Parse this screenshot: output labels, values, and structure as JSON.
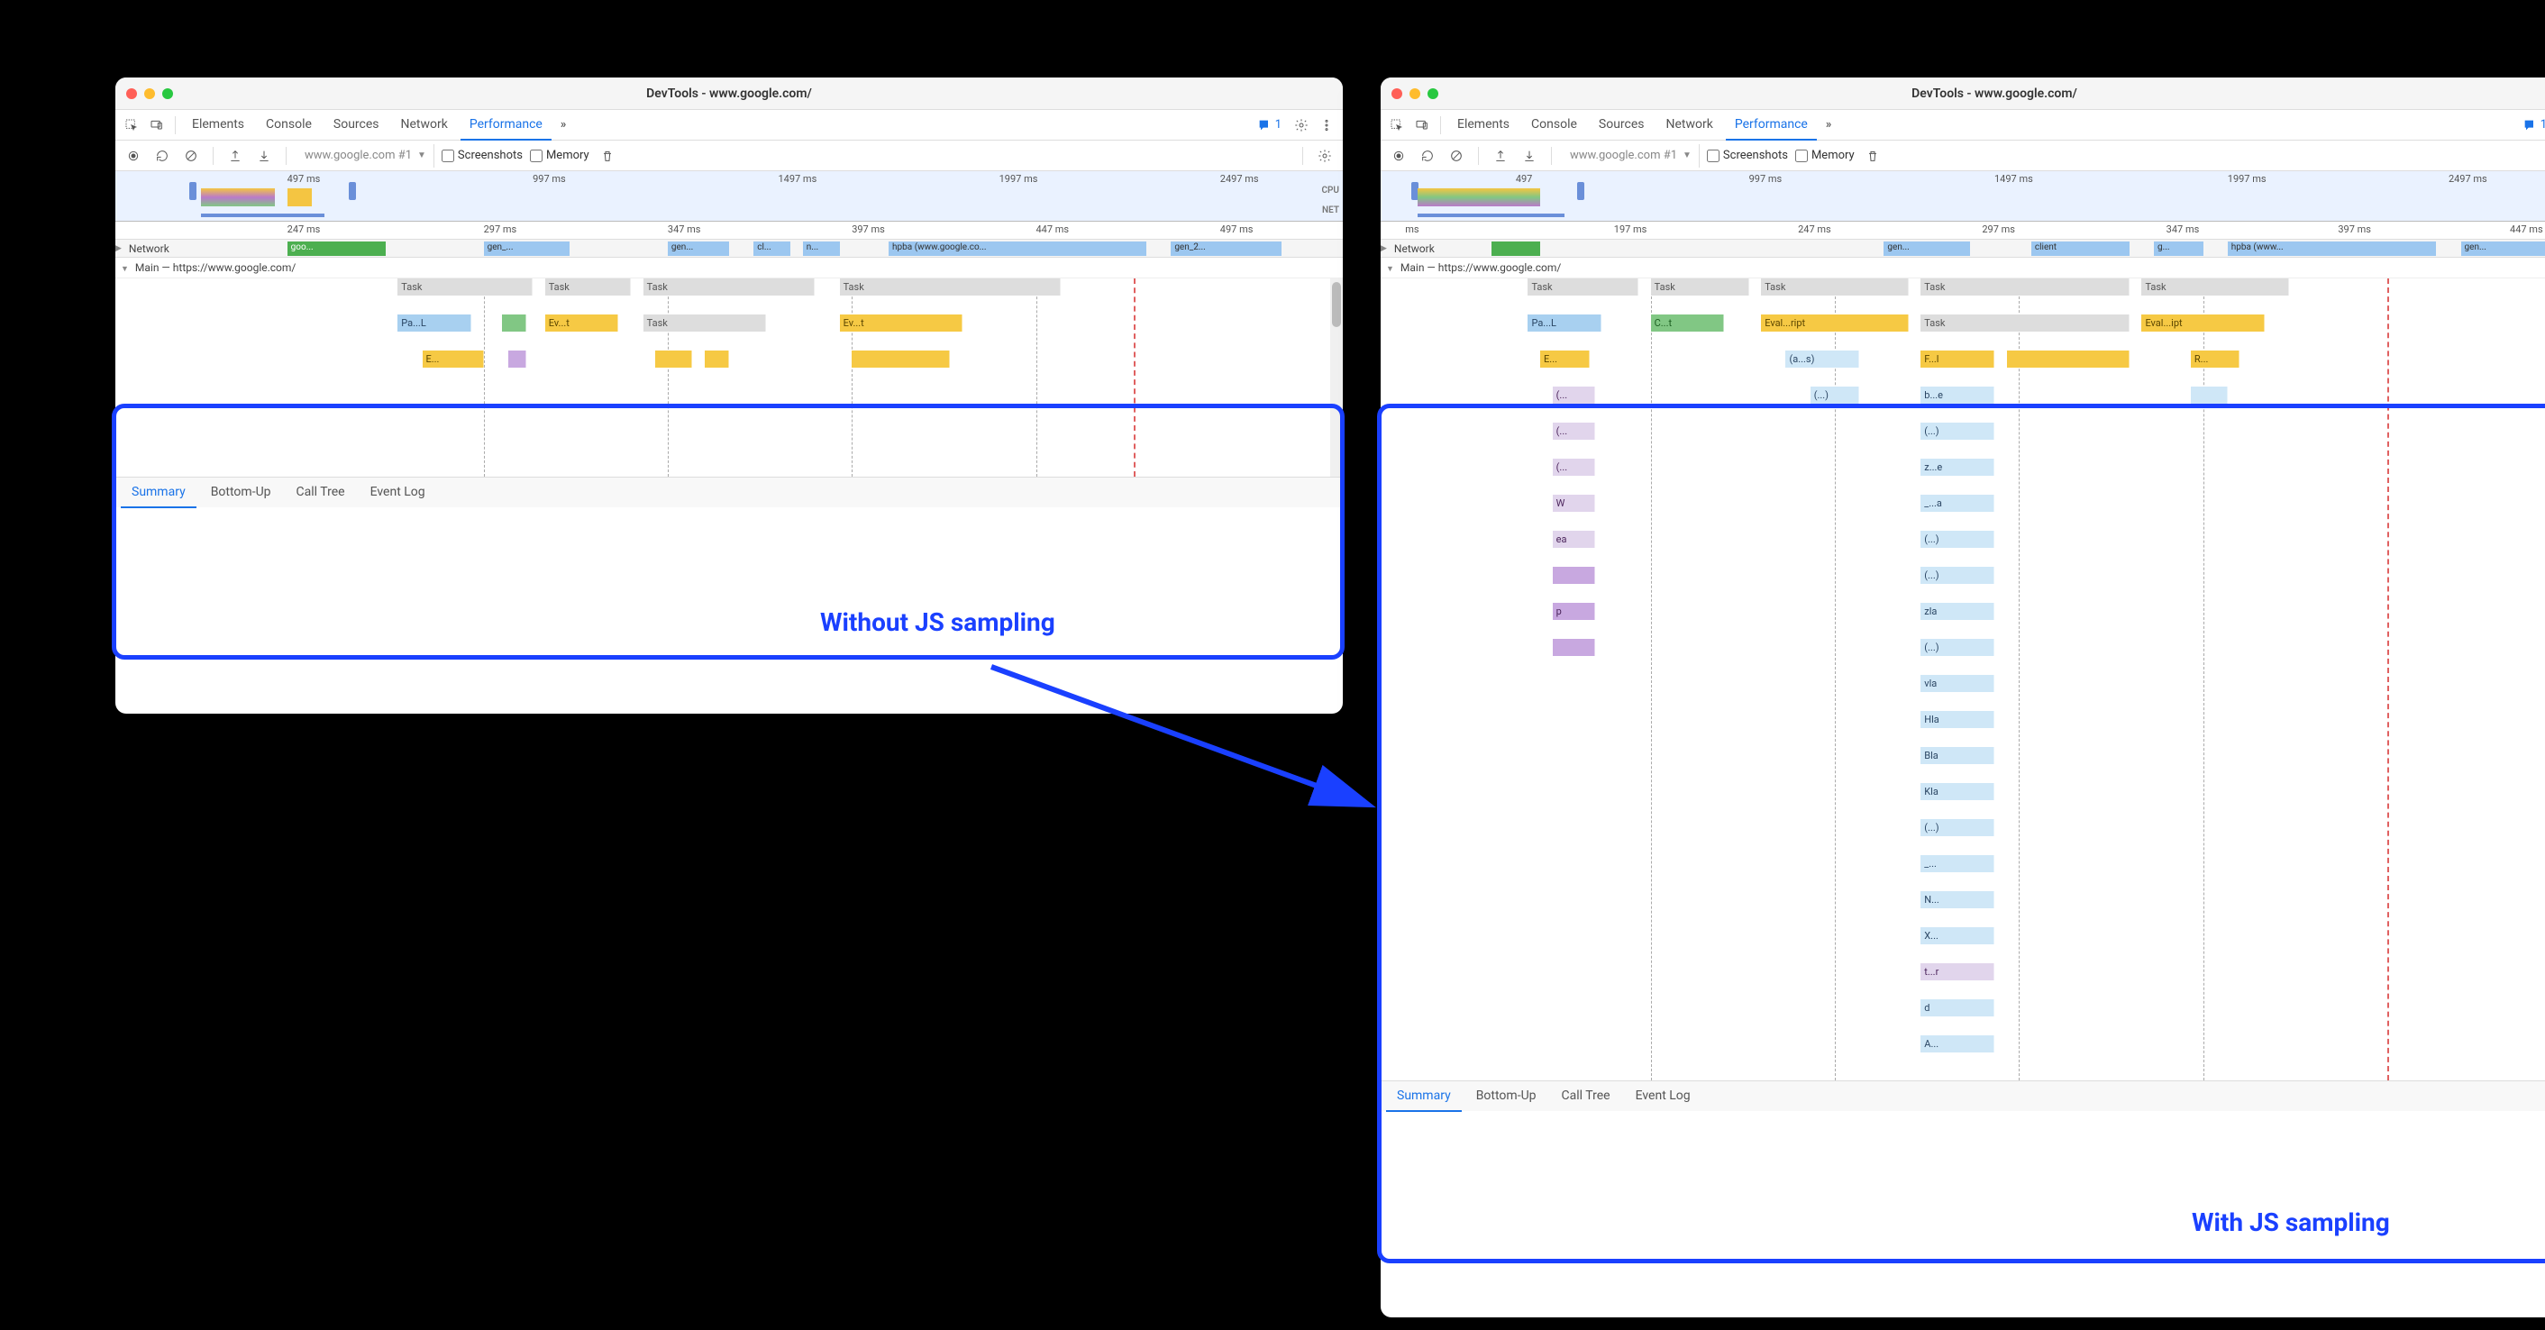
{
  "colors": {
    "accent": "#1a73e8",
    "annotation": "#1a40ff"
  },
  "window_left": {
    "title": "DevTools - www.google.com/",
    "tabs": [
      "Elements",
      "Console",
      "Sources",
      "Network",
      "Performance"
    ],
    "active_tab": "Performance",
    "issues_count": "1",
    "recording_dropdown": "www.google.com #1",
    "checkboxes": {
      "screenshots": "Screenshots",
      "memory": "Memory"
    },
    "overview_ticks": [
      "497 ms",
      "997 ms",
      "1497 ms",
      "1997 ms",
      "2497 ms"
    ],
    "overview_labels": {
      "cpu": "CPU",
      "net": "NET"
    },
    "ruler_ticks": [
      "247 ms",
      "297 ms",
      "347 ms",
      "397 ms",
      "447 ms",
      "497 ms"
    ],
    "network_label": "Network",
    "network_items": [
      "goo...",
      "gen_...",
      "gen...",
      "cl...",
      "n...",
      "hpba (www.google.co...",
      "gen_2..."
    ],
    "main_label": "Main — https://www.google.com/",
    "flame_rows": [
      [
        {
          "l": "Task",
          "c": "c-gray",
          "x": 23,
          "w": 11
        },
        {
          "l": "Task",
          "c": "c-gray",
          "x": 35,
          "w": 7
        },
        {
          "l": "Task",
          "c": "c-gray",
          "x": 43,
          "w": 14
        },
        {
          "l": "Task",
          "c": "c-gray",
          "x": 59,
          "w": 18
        }
      ],
      [
        {
          "l": "Pa...L",
          "c": "c-blue",
          "x": 23,
          "w": 6
        },
        {
          "l": "",
          "c": "c-green",
          "x": 31.5,
          "w": 2
        },
        {
          "l": "Ev...t",
          "c": "c-yellow",
          "x": 35,
          "w": 6
        },
        {
          "l": "Task",
          "c": "c-gray",
          "x": 43,
          "w": 10
        },
        {
          "l": "Ev...t",
          "c": "c-yellow",
          "x": 59,
          "w": 10
        }
      ],
      [
        {
          "l": "E...",
          "c": "c-yellow",
          "x": 25,
          "w": 5
        },
        {
          "l": "",
          "c": "c-purple",
          "x": 32,
          "w": 1.5
        },
        {
          "l": "",
          "c": "c-yellow",
          "x": 44,
          "w": 3
        },
        {
          "l": "",
          "c": "c-yellow",
          "x": 48,
          "w": 2
        },
        {
          "l": "",
          "c": "c-yellow",
          "x": 60,
          "w": 8
        }
      ]
    ],
    "annotation": "Without JS sampling",
    "details_tabs": [
      "Summary",
      "Bottom-Up",
      "Call Tree",
      "Event Log"
    ],
    "active_details_tab": "Summary"
  },
  "window_right": {
    "title": "DevTools - www.google.com/",
    "tabs": [
      "Elements",
      "Console",
      "Sources",
      "Network",
      "Performance"
    ],
    "active_tab": "Performance",
    "issues_count": "1",
    "recording_dropdown": "www.google.com #1",
    "checkboxes": {
      "screenshots": "Screenshots",
      "memory": "Memory"
    },
    "overview_ticks": [
      "497",
      "997 ms",
      "1497 ms",
      "1997 ms",
      "2497 ms"
    ],
    "overview_labels": {
      "cpu": "CPU",
      "net": "NET"
    },
    "ruler_ticks": [
      "ms",
      "197 ms",
      "247 ms",
      "297 ms",
      "347 ms",
      "397 ms",
      "447 ms"
    ],
    "network_label": "Network",
    "network_items": [
      "gen...",
      "client",
      "g...",
      "hpba (www...",
      "gen..."
    ],
    "main_label": "Main — https://www.google.com/",
    "flame_rows": [
      [
        {
          "l": "Task",
          "c": "c-gray",
          "x": 12,
          "w": 9
        },
        {
          "l": "Task",
          "c": "c-gray",
          "x": 22,
          "w": 8
        },
        {
          "l": "Task",
          "c": "c-gray",
          "x": 31,
          "w": 12
        },
        {
          "l": "Task",
          "c": "c-gray",
          "x": 44,
          "w": 17
        },
        {
          "l": "Task",
          "c": "c-gray",
          "x": 62,
          "w": 12
        }
      ],
      [
        {
          "l": "Pa...L",
          "c": "c-blue",
          "x": 12,
          "w": 6
        },
        {
          "l": "C...t",
          "c": "c-green",
          "x": 22,
          "w": 6
        },
        {
          "l": "Eval...ript",
          "c": "c-yellow",
          "x": 31,
          "w": 12
        },
        {
          "l": "Task",
          "c": "c-gray",
          "x": 44,
          "w": 17
        },
        {
          "l": "Eval...ipt",
          "c": "c-yellow",
          "x": 62,
          "w": 10
        }
      ],
      [
        {
          "l": "E...",
          "c": "c-yellow",
          "x": 13,
          "w": 4
        },
        {
          "l": "(a...s)",
          "c": "c-lightblue",
          "x": 33,
          "w": 6
        },
        {
          "l": "F...l",
          "c": "c-yellow",
          "x": 44,
          "w": 6
        },
        {
          "l": "",
          "c": "c-yellow",
          "x": 51,
          "w": 10
        },
        {
          "l": "R...",
          "c": "c-yellow",
          "x": 66,
          "w": 4
        }
      ],
      [
        {
          "l": "(...",
          "c": "c-lightpurple",
          "x": 14,
          "w": 3.5
        },
        {
          "l": "(...)",
          "c": "c-lightblue",
          "x": 35,
          "w": 4
        },
        {
          "l": "b...e",
          "c": "c-lightblue",
          "x": 44,
          "w": 6
        },
        {
          "l": "",
          "c": "c-lightblue",
          "x": 66,
          "w": 3
        }
      ],
      [
        {
          "l": "(...",
          "c": "c-lightpurple",
          "x": 14,
          "w": 3.5
        },
        {
          "l": "(...)",
          "c": "c-lightblue",
          "x": 44,
          "w": 6
        }
      ],
      [
        {
          "l": "(...",
          "c": "c-lightpurple",
          "x": 14,
          "w": 3.5
        },
        {
          "l": "z...e",
          "c": "c-lightblue",
          "x": 44,
          "w": 6
        }
      ],
      [
        {
          "l": "W",
          "c": "c-lightpurple",
          "x": 14,
          "w": 3.5
        },
        {
          "l": "_...a",
          "c": "c-lightblue",
          "x": 44,
          "w": 6
        }
      ],
      [
        {
          "l": "ea",
          "c": "c-lightpurple",
          "x": 14,
          "w": 3.5
        },
        {
          "l": "(...)",
          "c": "c-lightblue",
          "x": 44,
          "w": 6
        }
      ],
      [
        {
          "l": "",
          "c": "c-purple",
          "x": 14,
          "w": 3.5
        },
        {
          "l": "(...)",
          "c": "c-lightblue",
          "x": 44,
          "w": 6
        }
      ],
      [
        {
          "l": "p",
          "c": "c-purple",
          "x": 14,
          "w": 3.5
        },
        {
          "l": "zla",
          "c": "c-lightblue",
          "x": 44,
          "w": 6
        }
      ],
      [
        {
          "l": "",
          "c": "c-purple",
          "x": 14,
          "w": 3.5
        },
        {
          "l": "(...)",
          "c": "c-lightblue",
          "x": 44,
          "w": 6
        }
      ],
      [
        {
          "l": "vla",
          "c": "c-lightblue",
          "x": 44,
          "w": 6
        }
      ],
      [
        {
          "l": "Hla",
          "c": "c-lightblue",
          "x": 44,
          "w": 6
        }
      ],
      [
        {
          "l": "Bla",
          "c": "c-lightblue",
          "x": 44,
          "w": 6
        }
      ],
      [
        {
          "l": "Kla",
          "c": "c-lightblue",
          "x": 44,
          "w": 6
        }
      ],
      [
        {
          "l": "(...)",
          "c": "c-lightblue",
          "x": 44,
          "w": 6
        }
      ],
      [
        {
          "l": "_...",
          "c": "c-lightblue",
          "x": 44,
          "w": 6
        }
      ],
      [
        {
          "l": "N...",
          "c": "c-lightblue",
          "x": 44,
          "w": 6
        }
      ],
      [
        {
          "l": "X...",
          "c": "c-lightblue",
          "x": 44,
          "w": 6
        }
      ],
      [
        {
          "l": "t...r",
          "c": "c-lightpurple",
          "x": 44,
          "w": 6
        }
      ],
      [
        {
          "l": "d",
          "c": "c-lightblue",
          "x": 44,
          "w": 6
        }
      ],
      [
        {
          "l": "A...",
          "c": "c-lightblue",
          "x": 44,
          "w": 6
        }
      ]
    ],
    "annotation": "With JS sampling",
    "details_tabs": [
      "Summary",
      "Bottom-Up",
      "Call Tree",
      "Event Log"
    ],
    "active_details_tab": "Summary"
  }
}
